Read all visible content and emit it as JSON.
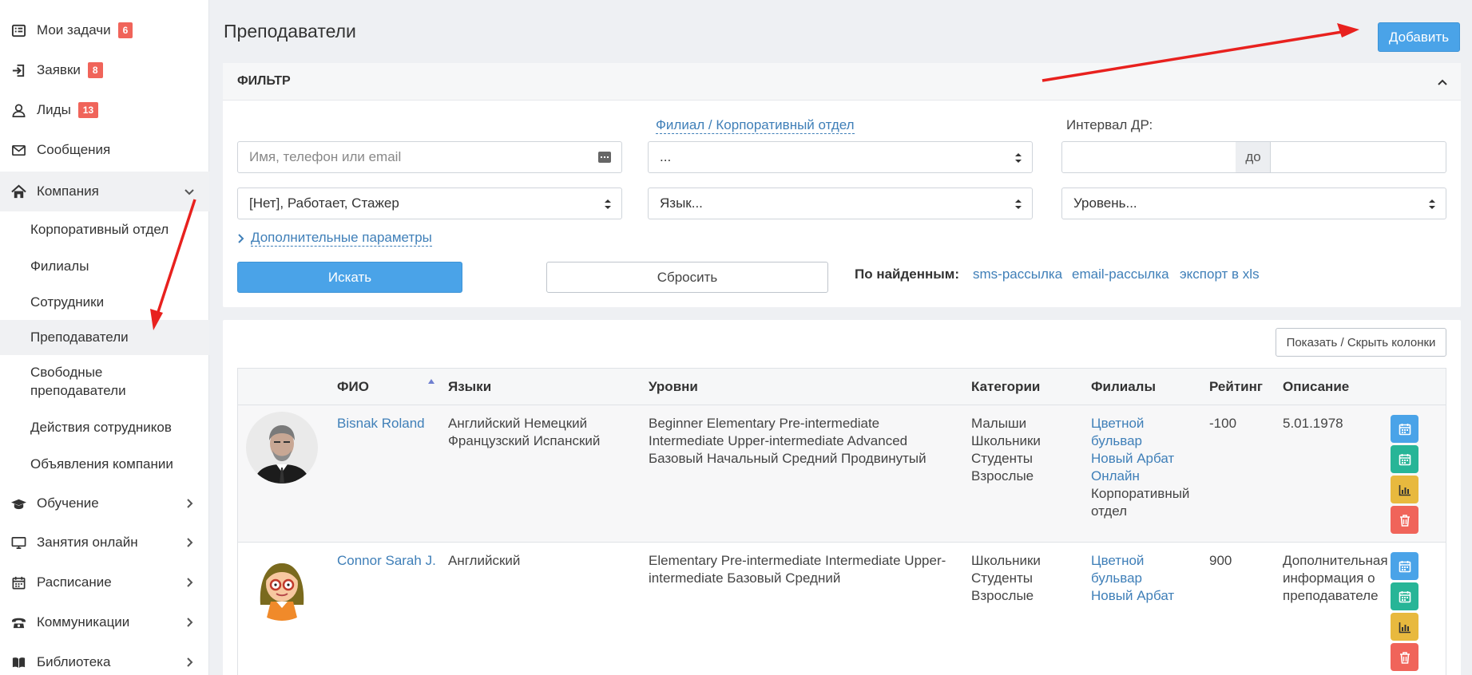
{
  "sidebar": {
    "items": [
      {
        "label": "Мои задачи",
        "badge": "6",
        "icon": "list-icon"
      },
      {
        "label": "Заявки",
        "badge": "8",
        "icon": "sign-in-icon"
      },
      {
        "label": "Лиды",
        "badge": "13",
        "icon": "user-icon"
      },
      {
        "label": "Сообщения",
        "icon": "envelope-icon"
      },
      {
        "label": "Компания",
        "icon": "home-icon",
        "expanded": true
      },
      {
        "label": "Обучение",
        "icon": "graduation-cap-icon"
      },
      {
        "label": "Занятия онлайн",
        "icon": "monitor-icon"
      },
      {
        "label": "Расписание",
        "icon": "calendar-icon"
      },
      {
        "label": "Коммуникации",
        "icon": "phone-icon"
      },
      {
        "label": "Библиотека",
        "icon": "book-icon"
      }
    ],
    "sub_items": [
      "Корпоративный отдел",
      "Филиалы",
      "Сотрудники",
      "Преподаватели",
      "Свободные преподаватели",
      "Действия сотрудников",
      "Объявления компании"
    ],
    "active_sub": "Преподаватели"
  },
  "header": {
    "title": "Преподаватели",
    "add_label": "Добавить"
  },
  "filter": {
    "title": "ФИЛЬТР",
    "search_placeholder": "Имя, телефон или email",
    "branch_label": "Филиал / Корпоративный отдел",
    "branch_value": "...",
    "birthday_label": "Интервал ДР:",
    "birthday_to": "до",
    "status_value": "[Нет], Работает, Стажер",
    "language_value": "Язык...",
    "level_value": "Уровень...",
    "more_params": "Дополнительные параметры",
    "search_label": "Искать",
    "reset_label": "Сбросить",
    "found_label": "По найденным:",
    "found_links": [
      "sms-рассылка",
      "email-рассылка",
      "экспорт в xls"
    ]
  },
  "table": {
    "toggle_columns": "Показать / Скрыть колонки",
    "headers": {
      "name": "ФИО",
      "languages": "Языки",
      "levels": "Уровни",
      "categories": "Категории",
      "branches": "Филиалы",
      "rating": "Рейтинг",
      "description": "Описание"
    },
    "rows": [
      {
        "name": "Bisnak Roland",
        "languages": [
          "Английский Немецкий",
          "Французский Испанский"
        ],
        "levels": [
          "Beginner Elementary Pre-intermediate",
          "Intermediate Upper-intermediate Advanced",
          "Базовый Начальный Средний Продвинутый"
        ],
        "categories": [
          "Малыши",
          "Школьники",
          "Студенты",
          "Взрослые"
        ],
        "branches_links": [
          "Цветной",
          "бульвар",
          "Новый Арбат",
          "Онлайн"
        ],
        "branches_text": [
          "Корпоративный",
          "отдел"
        ],
        "rating": "-100",
        "description": [
          "5.01.1978"
        ]
      },
      {
        "name": "Connor Sarah J.",
        "languages": [
          "Английский"
        ],
        "levels": [
          "Elementary Pre-intermediate Intermediate Upper-",
          "intermediate Базовый Средний"
        ],
        "categories": [
          "Школьники",
          "Студенты",
          "Взрослые"
        ],
        "branches_links": [
          "Цветной",
          "бульвар",
          "Новый Арбат"
        ],
        "branches_text": [],
        "rating": "900",
        "description": [
          "Дополнительная",
          "информация о",
          "преподавателе"
        ]
      }
    ]
  },
  "colors": {
    "primary": "#4aa3e8",
    "link": "#3f7fb8",
    "badge": "#f0645a",
    "action_green": "#27b597",
    "action_yellow": "#e8b93e",
    "action_red": "#f0645a",
    "annotation_arrow": "#e8211e"
  }
}
